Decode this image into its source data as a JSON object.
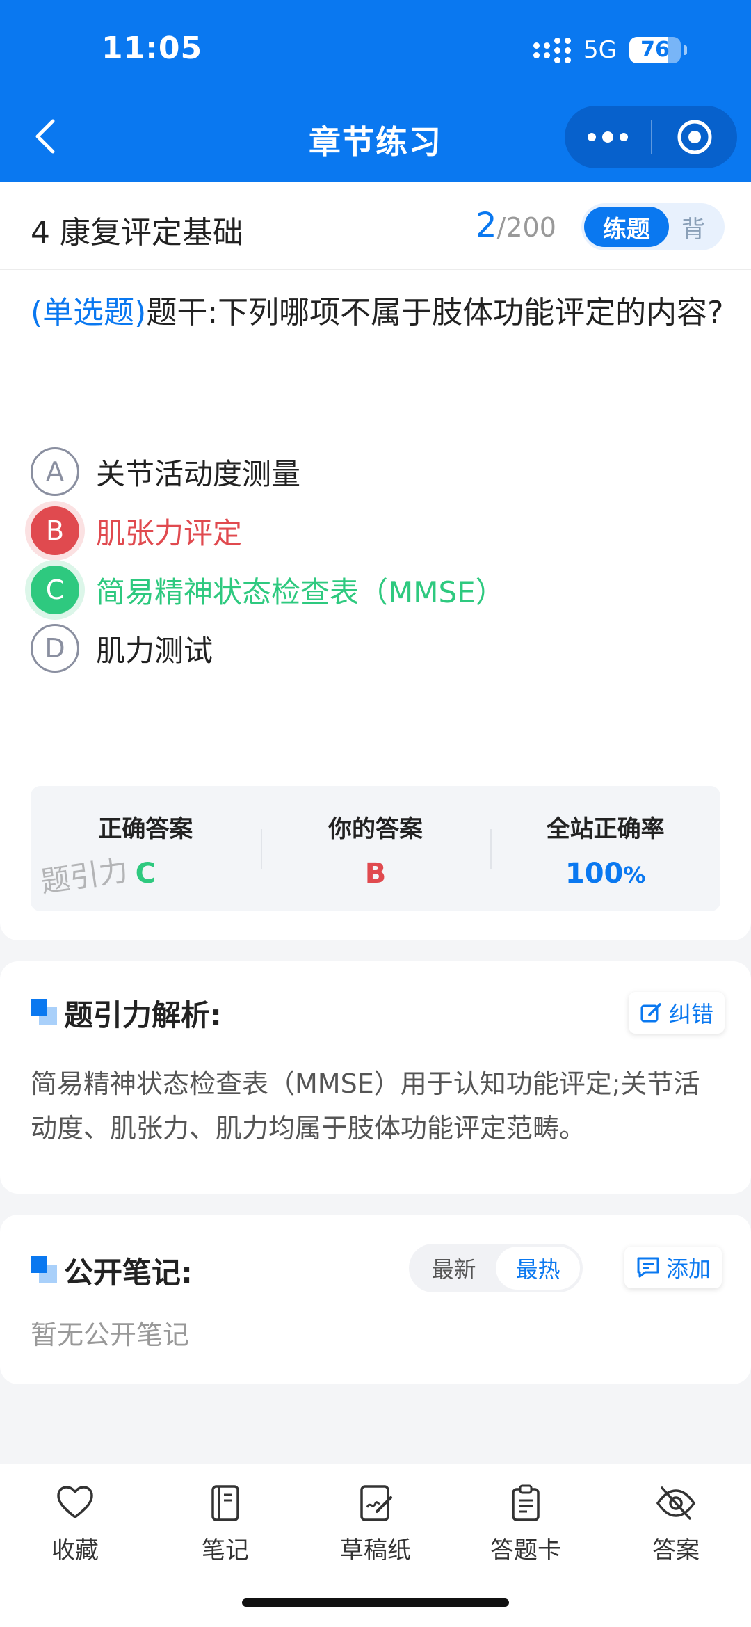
{
  "status_bar": {
    "time": "11:05",
    "network": "5G",
    "battery": "76",
    "battery_level": 0.76
  },
  "nav": {
    "title": "章节练习",
    "icons": [
      "back-icon",
      "more-icon",
      "target-icon"
    ]
  },
  "chapter": {
    "title": "4 康复评定基础",
    "current": "2",
    "total": "/200",
    "mode_active": "练题",
    "mode_inactive": "背"
  },
  "question": {
    "type": "(单选题)",
    "text": "题干:下列哪项不属于肢体功能评定的内容?",
    "options": [
      {
        "letter": "A",
        "text": "关节活动度测量",
        "state": "normal"
      },
      {
        "letter": "B",
        "text": "肌张力评定",
        "state": "wrong"
      },
      {
        "letter": "C",
        "text": "简易精神状态检查表（MMSE）",
        "state": "correct"
      },
      {
        "letter": "D",
        "text": "肌力测试",
        "state": "normal"
      }
    ]
  },
  "result": {
    "correct_label": "正确答案",
    "correct_value": "C",
    "yours_label": "你的答案",
    "yours_value": "B",
    "rate_label": "全站正确率",
    "rate_value": "100",
    "rate_unit": "%",
    "watermark": "题引力"
  },
  "analysis": {
    "title": "题引力解析:",
    "report_button": "纠错",
    "text": "简易精神状态检查表（MMSE）用于认知功能评定;关节活动度、肌张力、肌力均属于肢体功能评定范畴。"
  },
  "notes": {
    "title": "公开笔记:",
    "sort_newest": "最新",
    "sort_hottest": "最热",
    "add_button": "添加",
    "empty_text": "暂无公开笔记"
  },
  "tabbar": {
    "items": [
      {
        "label": "收藏",
        "icon": "heart-icon"
      },
      {
        "label": "笔记",
        "icon": "notebook-icon"
      },
      {
        "label": "草稿纸",
        "icon": "draft-icon"
      },
      {
        "label": "答题卡",
        "icon": "answer-sheet-icon"
      },
      {
        "label": "答案",
        "icon": "eye-off-icon"
      }
    ]
  },
  "colors": {
    "primary": "#0a78f0",
    "correct": "#2ec97f",
    "wrong": "#e04a4f"
  }
}
